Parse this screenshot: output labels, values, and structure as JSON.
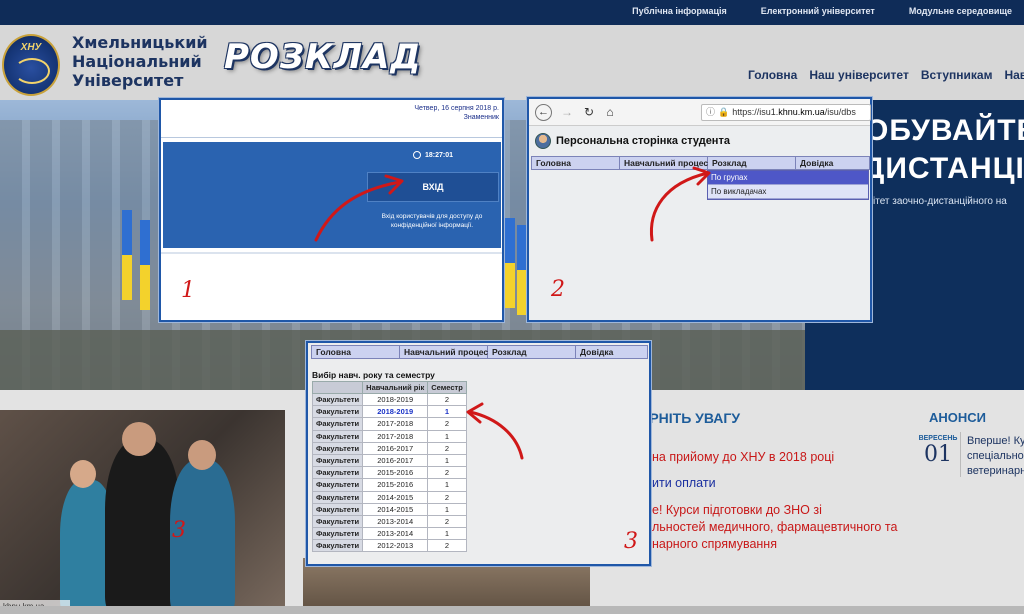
{
  "topbar": {
    "links": [
      "Публічна інформація",
      "Електронний університет",
      "Модульне середовище"
    ]
  },
  "header": {
    "logo_text": "ХНУ",
    "university_name": [
      "Хмельницький",
      "Національний",
      "Університет"
    ],
    "title": "РОЗКЛАД",
    "nav": [
      "Головна",
      "Наш університет",
      "Вступникам",
      "Навч"
    ]
  },
  "hero": {
    "heading_line1": "ОБУВАЙТЕ С",
    "heading_line2": "ДИСТАНЦІЙНО",
    "subtext": "ітет заочно-дистанційного на"
  },
  "window1": {
    "date_line1": "Четвер, 16 серпня 2018 р.",
    "date_line2": "Знаменник",
    "time": "18:27:01",
    "login_button": "ВХІД",
    "login_desc": "Вхід користувачів для доступу до конфіденційної інформації.",
    "step": "1"
  },
  "window2": {
    "url_scheme": "https://isu1.",
    "url_domain": "khnu.km.ua",
    "url_path": "/isu/dbs",
    "page_title": "Персональна сторінка студента",
    "menu": [
      "Головна",
      "Навчальний процес",
      "Розклад",
      "Довідка"
    ],
    "dropdown": [
      "По групах",
      "По викладачах"
    ],
    "step": "2"
  },
  "window3": {
    "menu": [
      "Головна",
      "Навчальний процес",
      "Розклад",
      "Довідка"
    ],
    "caption": "Вибір навч. року та семестру",
    "columns": [
      "",
      "Навчальний рік",
      "Семестр"
    ],
    "rows": [
      [
        "Факультети",
        "2018-2019",
        "2"
      ],
      [
        "Факультети",
        "2018-2019",
        "1"
      ],
      [
        "Факультети",
        "2017-2018",
        "2"
      ],
      [
        "Факультети",
        "2017-2018",
        "1"
      ],
      [
        "Факультети",
        "2016-2017",
        "2"
      ],
      [
        "Факультети",
        "2016-2017",
        "1"
      ],
      [
        "Факультети",
        "2015-2016",
        "2"
      ],
      [
        "Факультети",
        "2015-2016",
        "1"
      ],
      [
        "Факультети",
        "2014-2015",
        "2"
      ],
      [
        "Факультети",
        "2014-2015",
        "1"
      ],
      [
        "Факультети",
        "2013-2014",
        "2"
      ],
      [
        "Факультети",
        "2013-2014",
        "1"
      ],
      [
        "Факультети",
        "2012-2013",
        "2"
      ]
    ],
    "highlight_row": 1,
    "step": "3"
  },
  "bottom": {
    "photo_step": "3",
    "photo_url": "khnu.km.ua",
    "news_title": "ЕРНІТЬ УВАГУ",
    "news": [
      "на прийому до ХНУ в 2018 році",
      "ити оплати",
      "е! Курси підготовки до ЗНО зі",
      "льностей медичного, фармацевтичного та",
      "нарного спрямування"
    ],
    "anons_title": "АНОНСИ",
    "anons_month": "ВЕРЕСЕНЬ",
    "anons_day": "01",
    "anons_text": [
      "Вперше! Кур",
      "спеціально",
      "ветеринарн"
    ]
  },
  "colors": {
    "topbar": "#0f2c58",
    "accent_red": "#d01818",
    "menu_bg": "#ccd2f0",
    "window_border": "#1f57a8"
  }
}
